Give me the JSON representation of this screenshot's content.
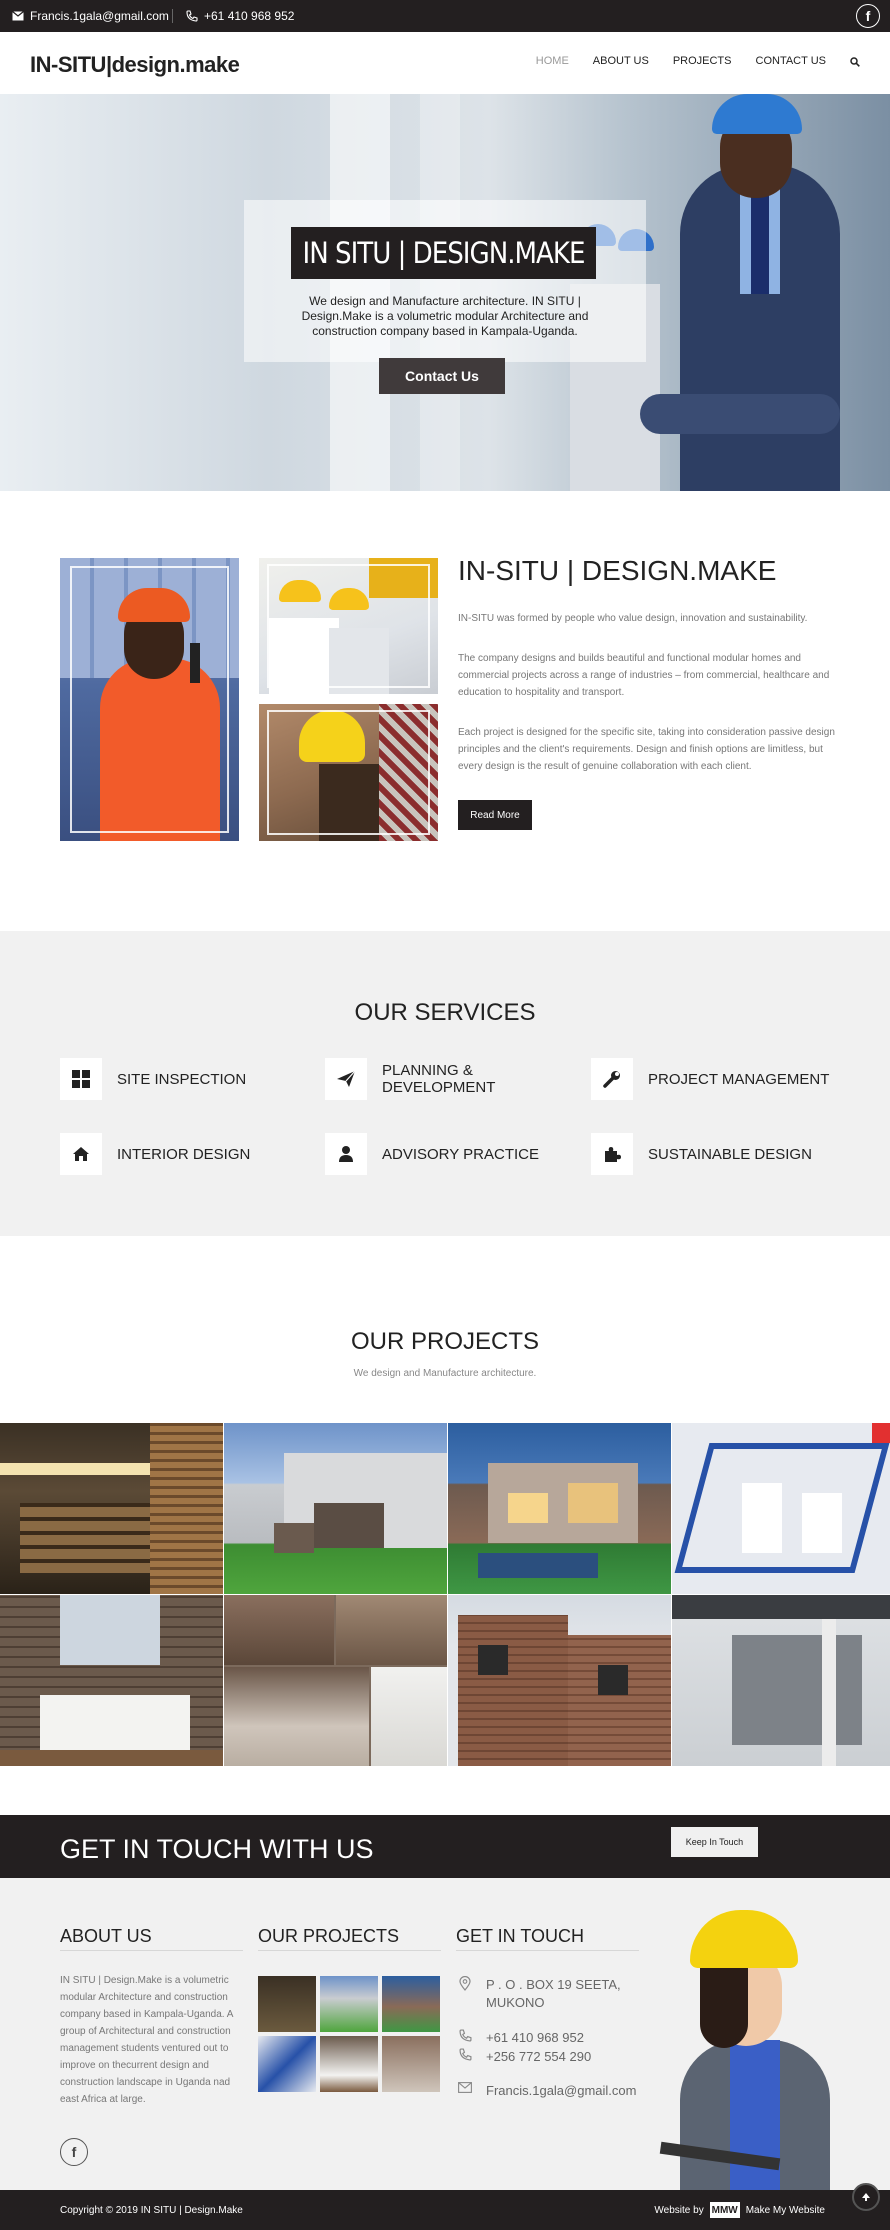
{
  "topbar": {
    "email": "Francis.1gala@gmail.com",
    "phone": "+61 410 968 952",
    "icons": [
      "envelope-icon",
      "phone-icon",
      "facebook-icon"
    ]
  },
  "header": {
    "logo": "IN-SITU|design.make",
    "nav": [
      "HOME",
      "ABOUT US",
      "PROJECTS",
      "CONTACT US"
    ],
    "active_nav": "HOME"
  },
  "hero": {
    "title": "IN SITU | DESIGN.MAKE",
    "description": "We design and Manufacture architecture. IN SITU | Design.Make is a volumetric modular Architecture and construction company based in Kampala-Uganda.",
    "button": "Contact Us"
  },
  "about": {
    "title": "IN-SITU | DESIGN.MAKE",
    "paragraphs": [
      "IN-SITU was formed by people who value design, innovation and sustainability.",
      "The company designs and builds beautiful and functional modular homes and commercial projects across a range of industries – from commercial, healthcare and education to hospitality and transport.",
      "Each project is designed for the specific site, taking into consideration passive design principles and the client's requirements. Design and finish options are limitless, but every design is the result of genuine collaboration with each client."
    ],
    "button": "Read More"
  },
  "services": {
    "title": "OUR SERVICES",
    "items": [
      {
        "label": "SITE INSPECTION",
        "icon": "grid-icon"
      },
      {
        "label": "PLANNING & DEVELOPMENT",
        "icon": "paper-plane-icon"
      },
      {
        "label": "PROJECT MANAGEMENT",
        "icon": "wrench-icon"
      },
      {
        "label": "INTERIOR DESIGN",
        "icon": "home-icon"
      },
      {
        "label": "ADVISORY PRACTICE",
        "icon": "user-icon"
      },
      {
        "label": "SUSTAINABLE DESIGN",
        "icon": "puzzle-icon"
      }
    ]
  },
  "projects": {
    "title": "OUR PROJECTS",
    "subtitle": "We design and Manufacture architecture."
  },
  "contact_strip": {
    "title": "GET IN TOUCH WITH US",
    "button": "Keep In Touch"
  },
  "footer": {
    "about_title": "ABOUT US",
    "about_text": "IN SITU | Design.Make is a volumetric modular Architecture and construction company based in Kampala-Uganda. A group of Architectural and construction management students ventured out to improve on thecurrent design and construction landscape in Uganda nad east Africa at large.",
    "projects_title": "OUR PROJECTS",
    "contact_title": "GET IN TOUCH",
    "address_line1": "P . O . BOX 19 SEETA,",
    "address_line2": "MUKONO",
    "phone1": "+61 410 968 952",
    "phone2": "+256 772 554 290",
    "email": "Francis.1gala@gmail.com"
  },
  "bottom": {
    "copyright": "Copyright © 2019 IN SITU | Design.Make",
    "credit_prefix": "Website by",
    "credit_logo": "MMW",
    "credit_suffix": "Make My Website"
  }
}
